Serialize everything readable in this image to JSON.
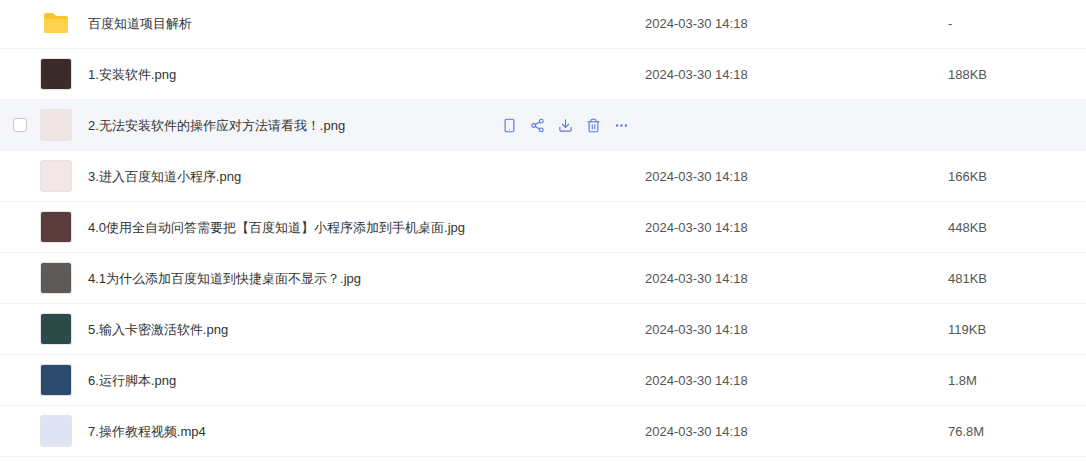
{
  "file_list": {
    "rows": [
      {
        "name": "百度知道项目解析",
        "date": "2024-03-30 14:18",
        "size": "-",
        "kind": "folder",
        "hovered": false,
        "checked": false,
        "color": "#f9c52a"
      },
      {
        "name": "1.安装软件.png",
        "date": "2024-03-30 14:18",
        "size": "188KB",
        "kind": "image",
        "hovered": false,
        "checked": false,
        "color": "#3b2b2b"
      },
      {
        "name": "2.无法安装软件的操作应对方法请看我！.png",
        "date": "",
        "size": "",
        "kind": "image",
        "hovered": true,
        "checked": false,
        "color": "#f1e4e4"
      },
      {
        "name": "3.进入百度知道小程序.png",
        "date": "2024-03-30 14:18",
        "size": "166KB",
        "kind": "image",
        "hovered": false,
        "checked": false,
        "color": "#f3e6e6"
      },
      {
        "name": "4.0使用全自动问答需要把【百度知道】小程序添加到手机桌面.jpg",
        "date": "2024-03-30 14:18",
        "size": "448KB",
        "kind": "image",
        "hovered": false,
        "checked": false,
        "color": "#5a3c3c"
      },
      {
        "name": "4.1为什么添加百度知道到快捷桌面不显示？.jpg",
        "date": "2024-03-30 14:18",
        "size": "481KB",
        "kind": "image",
        "hovered": false,
        "checked": false,
        "color": "#5d5a58"
      },
      {
        "name": "5.输入卡密激活软件.png",
        "date": "2024-03-30 14:18",
        "size": "119KB",
        "kind": "image",
        "hovered": false,
        "checked": false,
        "color": "#2c4a48"
      },
      {
        "name": "6.运行脚本.png",
        "date": "2024-03-30 14:18",
        "size": "1.8M",
        "kind": "image",
        "hovered": false,
        "checked": false,
        "color": "#2c4a6c"
      },
      {
        "name": "7.操作教程视频.mp4",
        "date": "2024-03-30 14:18",
        "size": "76.8M",
        "kind": "video",
        "hovered": false,
        "checked": false,
        "color": "#dfe3f3"
      }
    ]
  }
}
